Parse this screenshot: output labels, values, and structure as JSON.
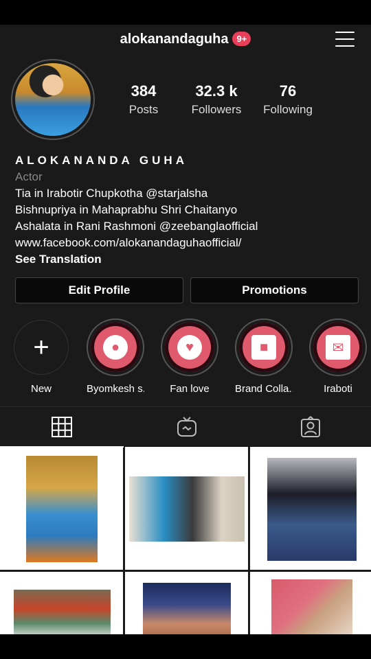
{
  "header": {
    "username": "alokanandaguha",
    "notifications": "9+"
  },
  "stats": [
    {
      "value": "384",
      "label": "Posts"
    },
    {
      "value": "32.3 k",
      "label": "Followers"
    },
    {
      "value": "76",
      "label": "Following"
    }
  ],
  "bio": {
    "name": "ALOKANANDA GUHA",
    "category": "Actor",
    "lines": [
      "Tia in Irabotir Chupkotha @starjalsha",
      "Bishnupriya in Mahaprabhu Shri Chaitanyo",
      "Ashalata in Rani Rashmoni @zeebanglaofficial",
      "www.facebook.com/alokanandaguhaofficial/"
    ],
    "see_translation": "See Translation"
  },
  "buttons": {
    "edit_profile": "Edit Profile",
    "promotions": "Promotions"
  },
  "highlights": [
    {
      "label": "New",
      "icon": "plus-icon"
    },
    {
      "label": "Byomkesh s...",
      "icon": "lightbulb-icon"
    },
    {
      "label": "Fan love",
      "icon": "heart-balloons-icon"
    },
    {
      "label": "Brand Colla...",
      "icon": "gift-icon"
    },
    {
      "label": "Iraboti",
      "icon": "love-letter-icon"
    }
  ],
  "tabs": [
    {
      "name": "grid-icon",
      "active": true
    },
    {
      "name": "igtv-icon",
      "active": false
    },
    {
      "name": "tagged-icon",
      "active": false
    }
  ],
  "colors": {
    "background": "#1a1a1a",
    "badge": "#e8405a",
    "highlight": "#e05a6e"
  }
}
